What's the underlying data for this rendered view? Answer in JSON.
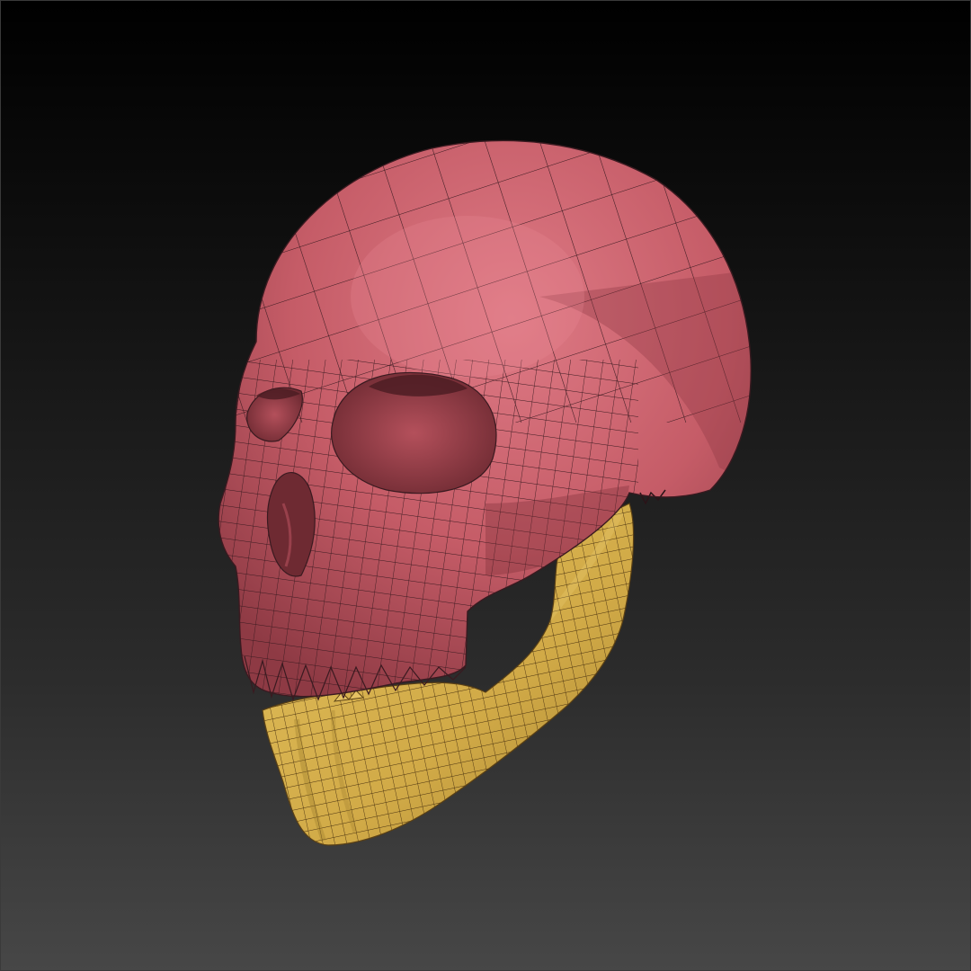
{
  "scene": {
    "subject": "skull-model",
    "parts": [
      {
        "name": "cranium",
        "color": "#c9606a"
      },
      {
        "name": "mandible",
        "color": "#d8b24e"
      }
    ],
    "wireframe_color": "#2a1418",
    "background_top": "#000000",
    "background_bottom": "#474747"
  }
}
